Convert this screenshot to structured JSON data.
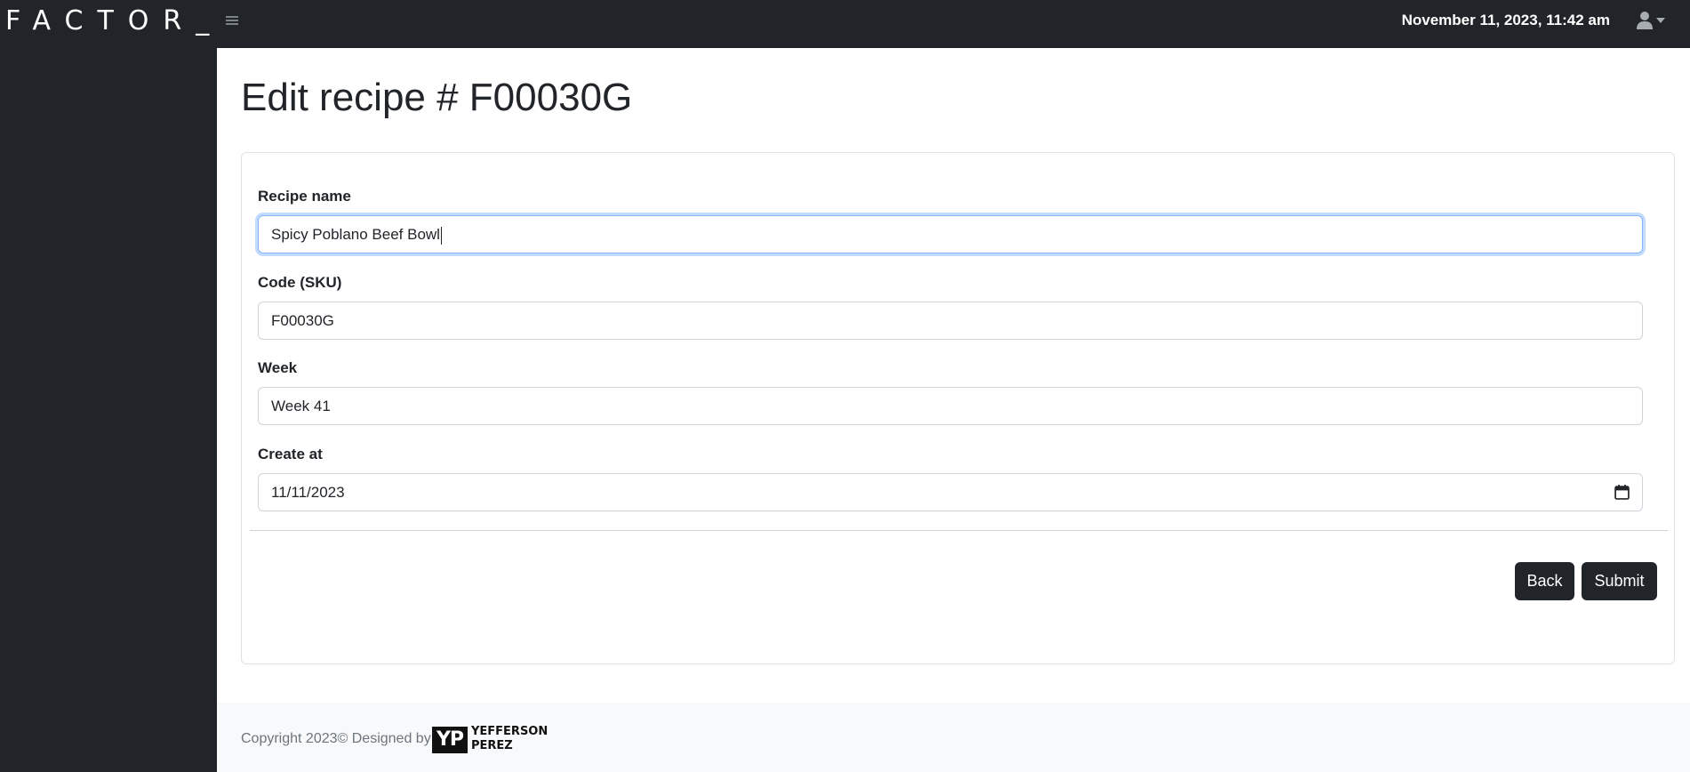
{
  "app": {
    "brand": "FACTOR_",
    "datetime": "November 11, 2023, 11:42 am",
    "icons": {
      "menu": "hamburger-icon",
      "user": "user-icon",
      "caret": "chevron-down-icon",
      "calendar": "calendar-icon"
    }
  },
  "page": {
    "title": "Edit recipe # F00030G"
  },
  "form": {
    "recipe_name_label": "Recipe name",
    "recipe_name_value": "Spicy Poblano Beef Bowl",
    "code_label": "Code (SKU)",
    "code_value": "F00030G",
    "week_label": "Week",
    "week_value": "Week 41",
    "created_label": "Create at",
    "created_value": "11/11/2023",
    "back_label": "Back",
    "submit_label": "Submit"
  },
  "footer": {
    "copyright": "Copyright 2023© Designed by",
    "logo_initials": "YP",
    "logo_first": "YEFFERSON",
    "logo_last": "PEREZ"
  },
  "colors": {
    "dark": "#212529",
    "footer_bg": "#f8f9fa",
    "focus_border": "#86b7fe"
  }
}
